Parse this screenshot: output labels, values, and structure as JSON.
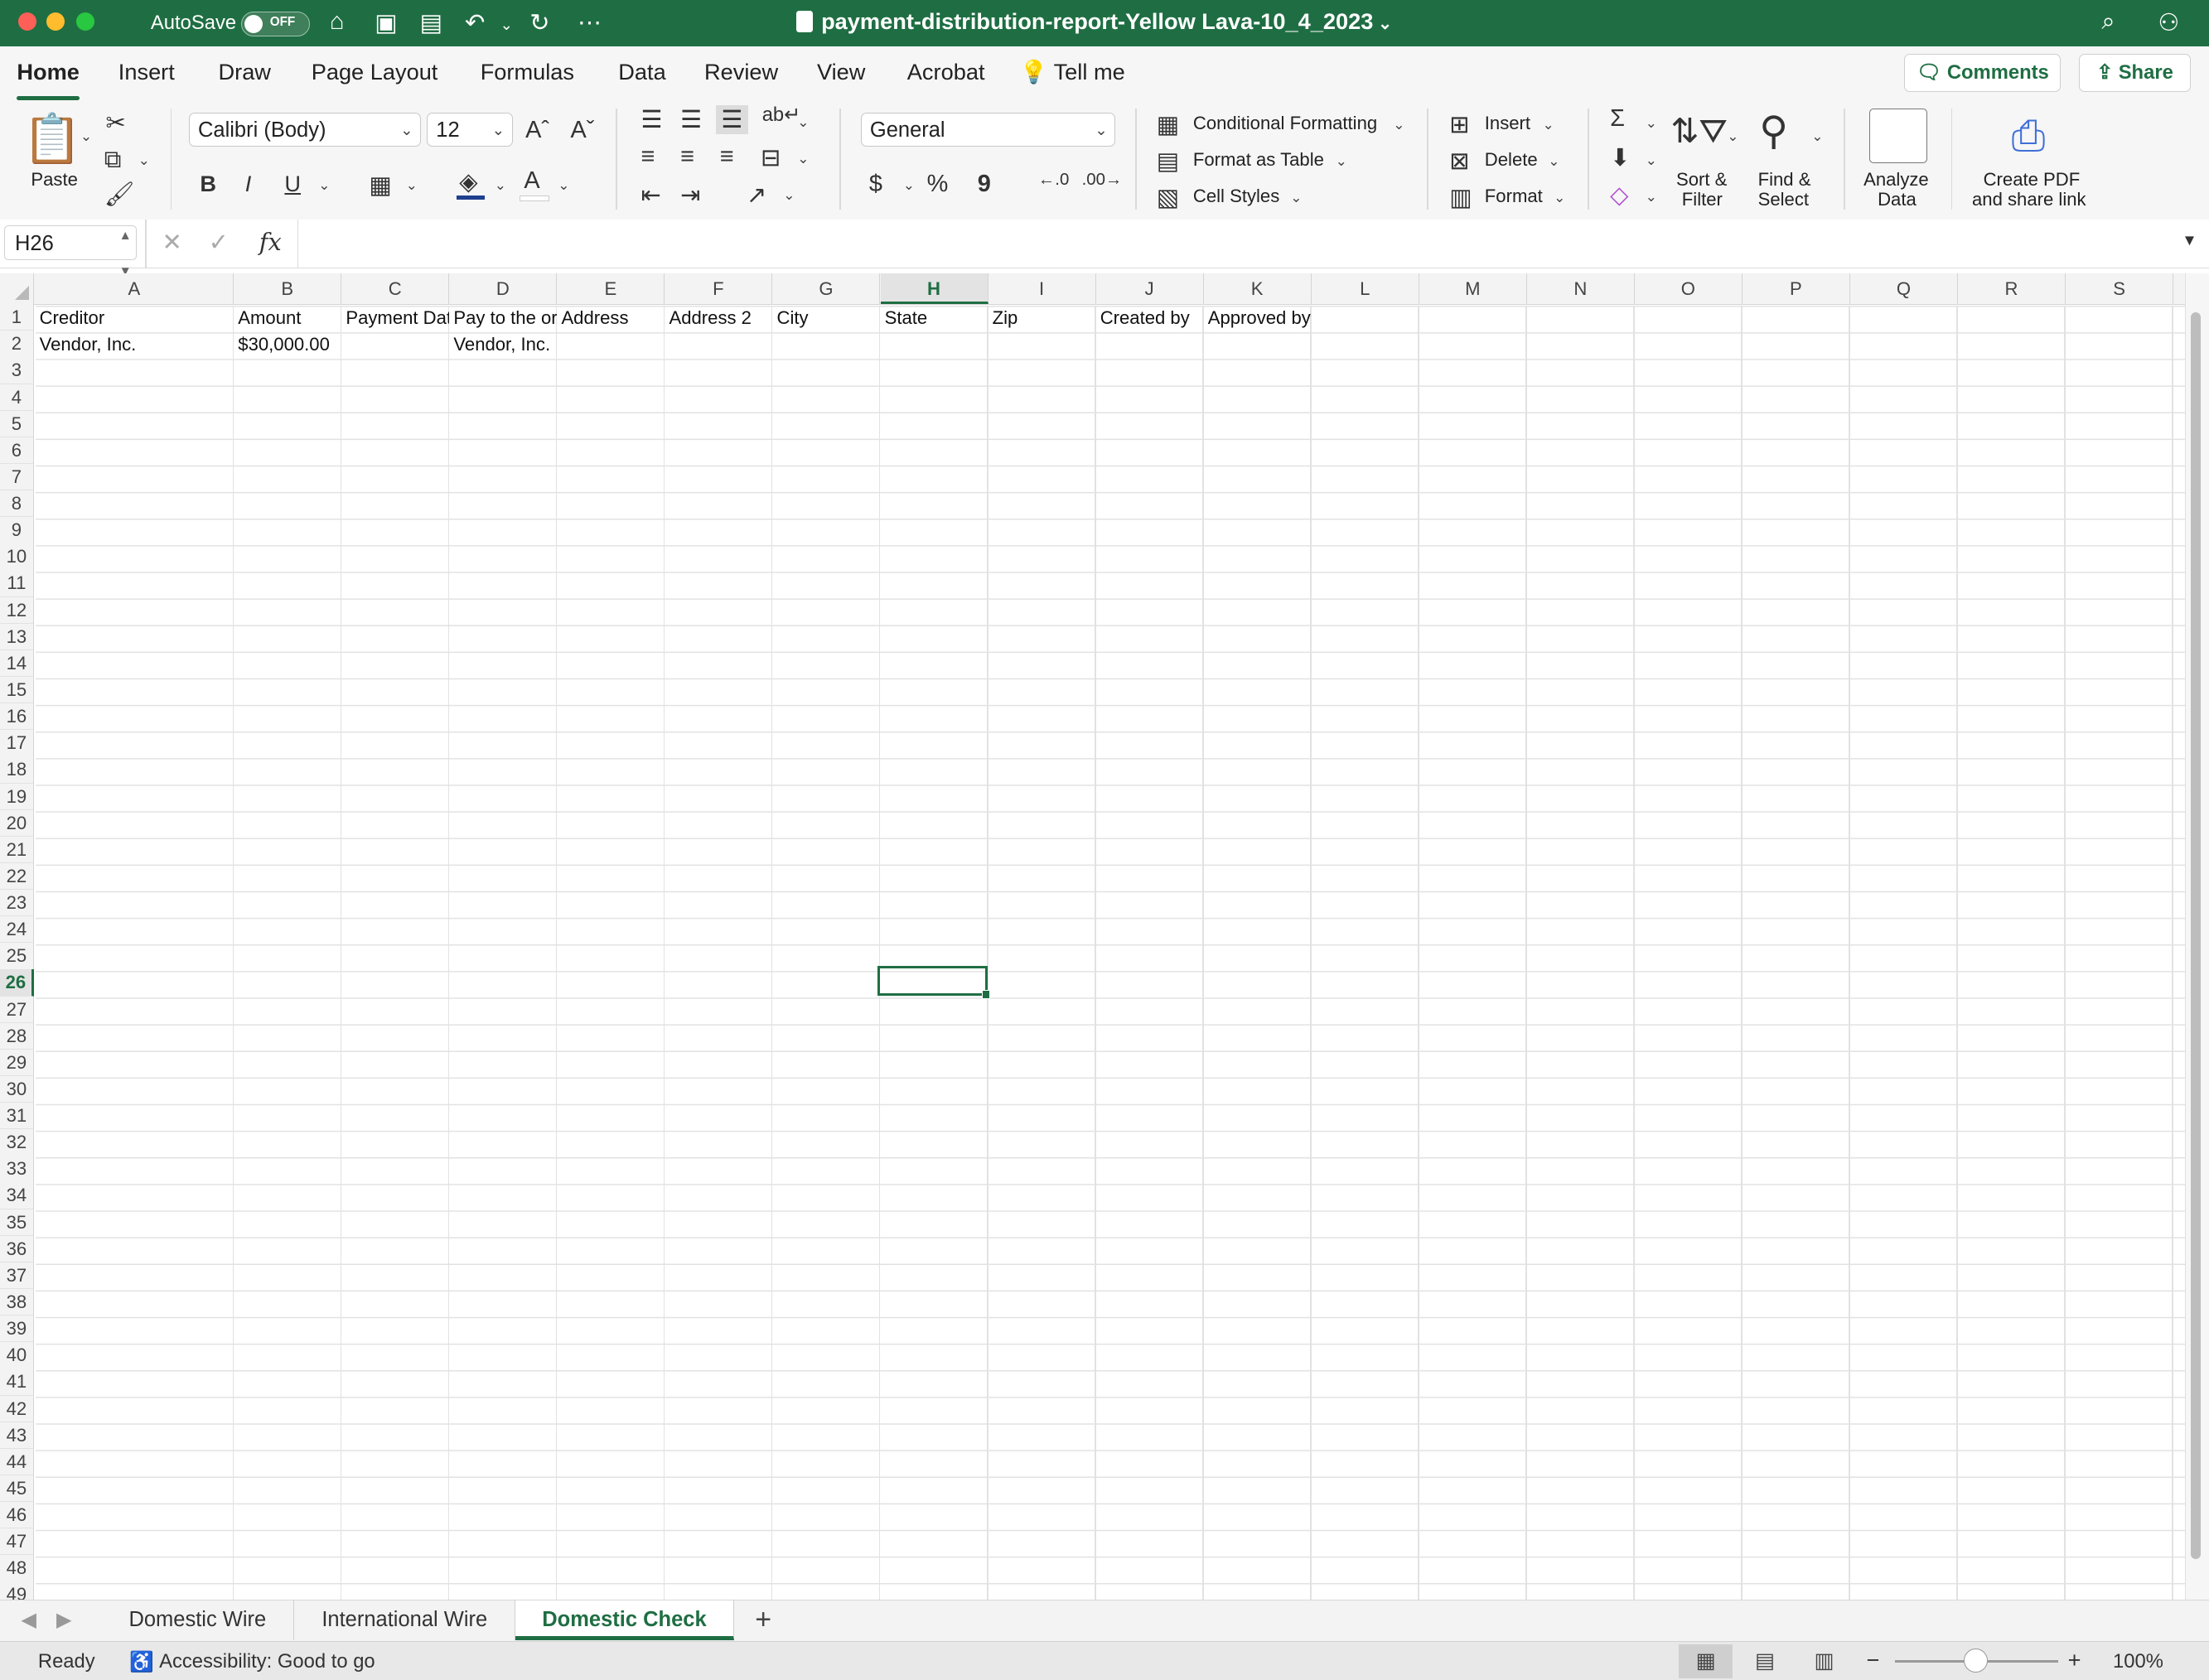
{
  "titlebar": {
    "autosave_label": "AutoSave",
    "toggle_state": "OFF",
    "document_title": "payment-distribution-report-Yellow Lava-10_4_2023",
    "icons": [
      "home-icon",
      "save-icon",
      "save-as-icon",
      "undo-icon",
      "redo-icon",
      "more-icon",
      "search-icon",
      "share-person-icon"
    ]
  },
  "ribbon_tabs": [
    "Home",
    "Insert",
    "Draw",
    "Page Layout",
    "Formulas",
    "Data",
    "Review",
    "View",
    "Acrobat"
  ],
  "tell_me": "Tell me",
  "comments_label": "Comments",
  "share_label": "Share",
  "ribbon": {
    "paste_label": "Paste",
    "font_name": "Calibri (Body)",
    "font_size": "12",
    "bold": "B",
    "italic": "I",
    "underline": "U",
    "number_format": "General",
    "currency": "$",
    "percent": "%",
    "comma": "9",
    "conditional_formatting": "Conditional Formatting",
    "format_as_table": "Format as Table",
    "cell_styles": "Cell Styles",
    "insert": "Insert",
    "delete": "Delete",
    "format": "Format",
    "sort_filter": "Sort &\nFilter",
    "sort_l1": "Sort &",
    "sort_l2": "Filter",
    "find_l1": "Find &",
    "find_l2": "Select",
    "analyze_l1": "Analyze",
    "analyze_l2": "Data",
    "pdf_l1": "Create PDF",
    "pdf_l2": "and share link"
  },
  "formula_bar": {
    "name_box": "H26",
    "fx": "fx",
    "value": ""
  },
  "grid": {
    "columns": [
      "A",
      "B",
      "C",
      "D",
      "E",
      "F",
      "G",
      "H",
      "I",
      "J",
      "K",
      "L",
      "M",
      "N",
      "O",
      "P",
      "Q",
      "R",
      "S"
    ],
    "selected_column": "H",
    "selected_row": 26,
    "selected_cell": "H26",
    "row_count": 49,
    "cells": {
      "A1": "Creditor",
      "B1": "Amount",
      "C1": "Payment Dat",
      "D1": "Pay to the or",
      "E1": "Address",
      "F1": "Address 2",
      "G1": "City",
      "H1": "State",
      "I1": "Zip",
      "J1": "Created by",
      "K1": "Approved by",
      "A2": "Vendor, Inc.",
      "B2": "$30,000.00",
      "D2": "Vendor, Inc."
    }
  },
  "sheets": [
    "Domestic Wire",
    "International Wire",
    "Domestic Check"
  ],
  "active_sheet": "Domestic Check",
  "status": {
    "ready": "Ready",
    "accessibility": "Accessibility: Good to go",
    "zoom": "100%"
  },
  "colors": {
    "brand_green": "#1f6e43"
  }
}
